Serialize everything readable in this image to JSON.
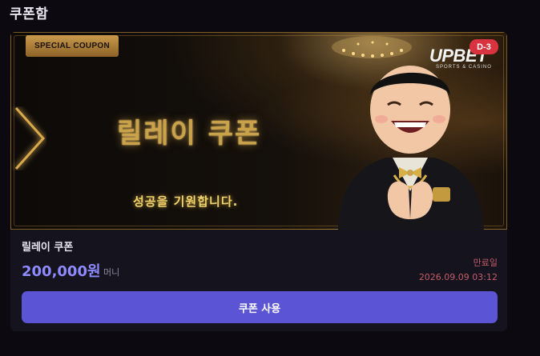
{
  "page": {
    "title": "쿠폰함"
  },
  "coupon": {
    "banner": {
      "tag": "SPECIAL COUPON",
      "title": "릴레이 쿠폰",
      "subtitle": "성공을 기원합니다.",
      "brand_main": "UPBET",
      "brand_sub": "SPORTS & CASINO",
      "dday": "D-3",
      "accent_color": "#caa24a",
      "mascot_icon": "mascot-illustration"
    },
    "name": "릴레이 쿠폰",
    "amount": "200,000원",
    "amount_unit": "머니",
    "expiry_label": "만료일",
    "expiry_date": "2026.09.09 03:12",
    "use_button_label": "쿠폰 사용",
    "button_color": "#5b54d4"
  }
}
